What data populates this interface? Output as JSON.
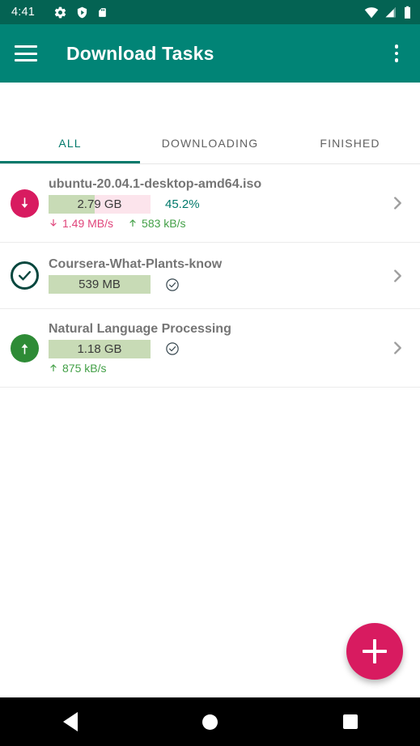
{
  "statusbar": {
    "time": "4:41",
    "left_icons": [
      "gear-icon",
      "shield-play-icon",
      "sd-card-icon"
    ],
    "right_icons": [
      "wifi-icon",
      "cell-signal-icon",
      "battery-icon"
    ],
    "background_color": "#046353"
  },
  "appbar": {
    "menu_icon": "hamburger-menu-icon",
    "title": "Download Tasks",
    "overflow_icon": "overflow-menu-icon",
    "background_color": "#018476"
  },
  "tabs": {
    "items": [
      {
        "label": "ALL",
        "active": true
      },
      {
        "label": "DOWNLOADING",
        "active": false
      },
      {
        "label": "FINISHED",
        "active": false
      }
    ],
    "indicator_color": "#00796b"
  },
  "tasks": [
    {
      "name": "ubuntu-20.04.1-desktop-amd64.iso",
      "status": "downloading",
      "status_icon": "download-arrow-circle-icon",
      "status_color": "#d81b60",
      "size": "2.79 GB",
      "percent": "45.2%",
      "progress": 45.2,
      "download_speed": "1.49 MB/s",
      "upload_speed": "583 kB/s",
      "complete": false,
      "chevron_icon": "chevron-right-icon"
    },
    {
      "name": "Coursera-What-Plants-know",
      "status": "complete",
      "status_icon": "check-circle-outline-icon",
      "status_color": "#07473e",
      "size": "539 MB",
      "percent": "",
      "progress": 100,
      "download_speed": "",
      "upload_speed": "",
      "complete": true,
      "chevron_icon": "chevron-right-icon"
    },
    {
      "name": "Natural Language Processing",
      "status": "seeding",
      "status_icon": "upload-arrow-circle-icon",
      "status_color": "#2e8b36",
      "size": "1.18 GB",
      "percent": "",
      "progress": 100,
      "download_speed": "",
      "upload_speed": "875 kB/s",
      "complete": true,
      "chevron_icon": "chevron-right-icon"
    }
  ],
  "fab": {
    "icon": "add-plus-icon",
    "color": "#d81b60"
  },
  "navbar": {
    "back": "back-triangle-icon",
    "home": "home-circle-icon",
    "recents": "recents-square-icon"
  }
}
